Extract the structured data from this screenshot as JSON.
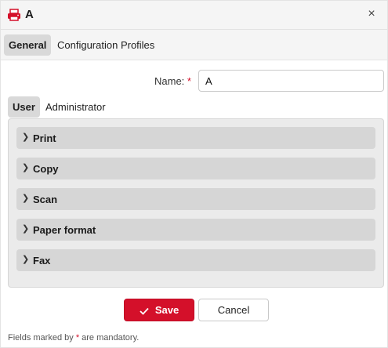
{
  "dialog": {
    "title": "A",
    "close_label": "×",
    "icon": "printer-icon",
    "accent_color": "#d4102a"
  },
  "tabs_top": [
    {
      "label": "General",
      "active": true
    },
    {
      "label": "Configuration Profiles",
      "active": false
    }
  ],
  "name_field": {
    "label": "Name:",
    "required_mark": "*",
    "value": "A"
  },
  "inner_tabs": [
    {
      "label": "User",
      "active": true
    },
    {
      "label": "Administrator",
      "active": false
    }
  ],
  "sections": [
    {
      "label": "Print",
      "expanded": false
    },
    {
      "label": "Copy",
      "expanded": false
    },
    {
      "label": "Scan",
      "expanded": false
    },
    {
      "label": "Paper format",
      "expanded": false
    },
    {
      "label": "Fax",
      "expanded": false
    }
  ],
  "buttons": {
    "save_label": "Save",
    "cancel_label": "Cancel"
  },
  "footnote": {
    "before": "Fields marked by ",
    "mark": "*",
    "after": " are mandatory."
  }
}
